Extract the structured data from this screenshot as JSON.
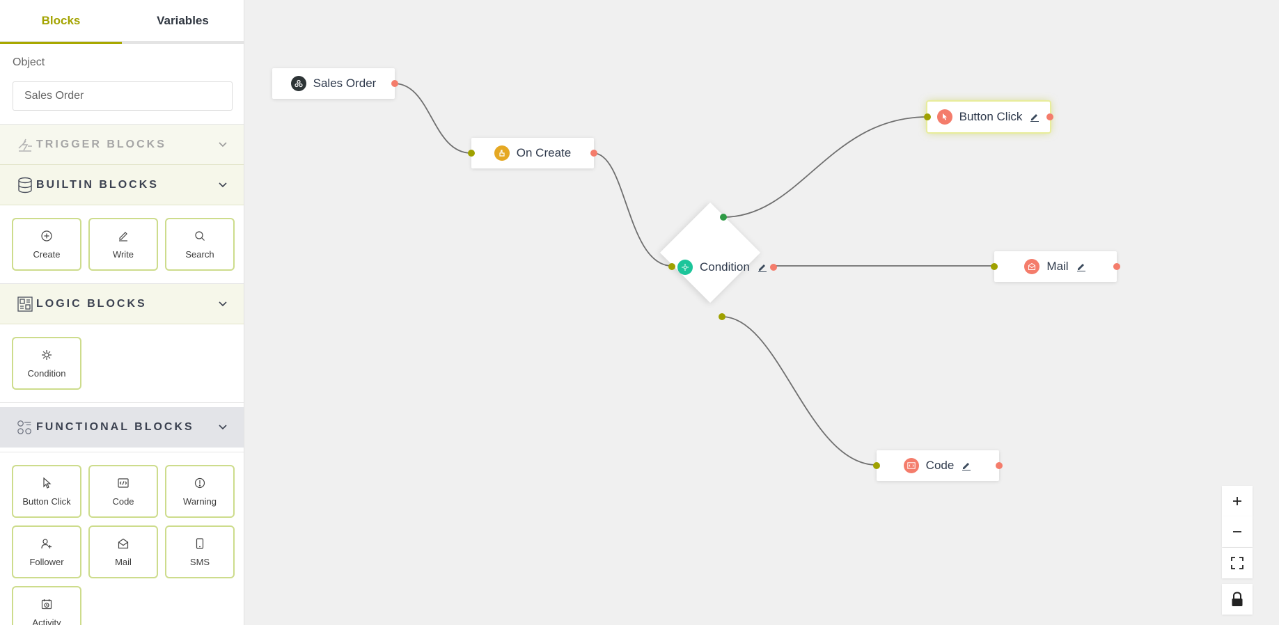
{
  "tabs": {
    "blocks": "Blocks",
    "variables": "Variables"
  },
  "object": {
    "label": "Object",
    "value": "Sales Order"
  },
  "sections": {
    "trigger": "TRIGGER BLOCKS",
    "builtin": "BUILTIN BLOCKS",
    "logic": "LOGIC BLOCKS",
    "functional": "FUNCTIONAL BLOCKS"
  },
  "builtin_blocks": [
    "Create",
    "Write",
    "Search"
  ],
  "logic_blocks": [
    "Condition"
  ],
  "functional_blocks": [
    "Button Click",
    "Code",
    "Warning",
    "Follower",
    "Mail",
    "SMS",
    "Activity"
  ],
  "nodes": {
    "sales_order": "Sales Order",
    "on_create": "On Create",
    "condition": "Condition",
    "button_click": "Button Click",
    "mail": "Mail",
    "code": "Code"
  },
  "colors": {
    "accent": "#a3a300",
    "card_border": "#cddc8c",
    "handle_red": "#f47c6b",
    "handle_olive": "#9fa100",
    "handle_green": "#2e9a45",
    "node_icon_dark": "#2d3436",
    "node_icon_yellow": "#e5a823",
    "node_icon_teal": "#1cc59a",
    "node_icon_red": "#f47c6b"
  },
  "controls": [
    "zoom-in-icon",
    "zoom-out-icon",
    "fit-view-icon",
    "lock-icon"
  ]
}
